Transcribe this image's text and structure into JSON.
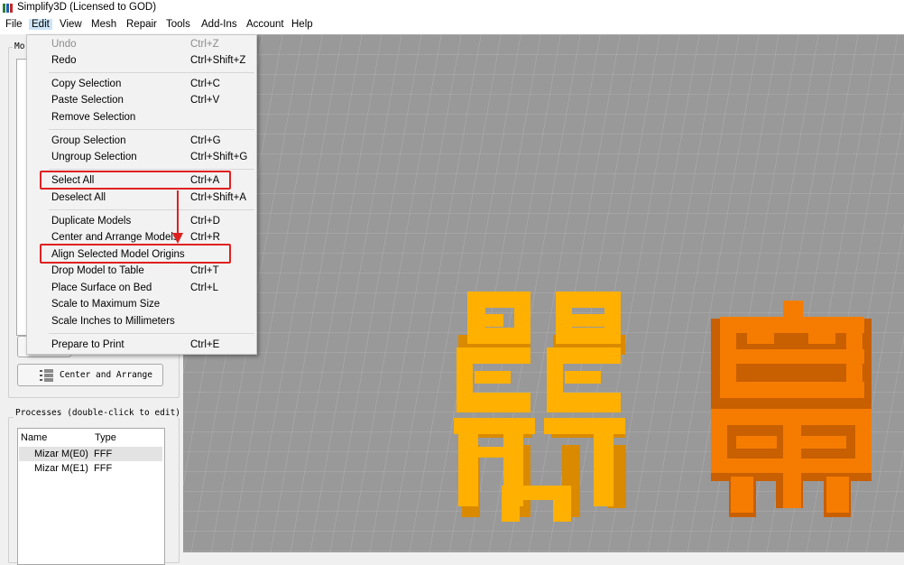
{
  "window": {
    "title": "Simplify3D (Licensed to GOD)"
  },
  "menubar": {
    "items": [
      "File",
      "Edit",
      "View",
      "Mesh",
      "Repair",
      "Tools",
      "Add-Ins",
      "Account",
      "Help"
    ]
  },
  "left_panel": {
    "models_group_label": "Mo",
    "center_arrange_label": "Center and Arrange",
    "processes_label": "Processes (double-click to edit)",
    "process_columns": [
      "Name",
      "Type"
    ],
    "processes": [
      {
        "name": "Mizar M(E0)",
        "type": "FFF"
      },
      {
        "name": "Mizar M(E1)",
        "type": "FFF"
      }
    ]
  },
  "edit_menu": {
    "items": [
      {
        "label": "Undo",
        "shortcut": "Ctrl+Z",
        "disabled": true
      },
      {
        "label": "Redo",
        "shortcut": "Ctrl+Shift+Z"
      },
      {
        "label": "Copy Selection",
        "shortcut": "Ctrl+C"
      },
      {
        "label": "Paste Selection",
        "shortcut": "Ctrl+V"
      },
      {
        "label": "Remove Selection",
        "shortcut": ""
      },
      {
        "label": "Group Selection",
        "shortcut": "Ctrl+G"
      },
      {
        "label": "Ungroup Selection",
        "shortcut": "Ctrl+Shift+G"
      },
      {
        "label": "Select All",
        "shortcut": "Ctrl+A"
      },
      {
        "label": "Deselect All",
        "shortcut": "Ctrl+Shift+A"
      },
      {
        "label": "Duplicate Models",
        "shortcut": "Ctrl+D"
      },
      {
        "label": "Center and Arrange Models",
        "shortcut": "Ctrl+R"
      },
      {
        "label": "Align Selected Model Origins",
        "shortcut": ""
      },
      {
        "label": "Drop Model to Table",
        "shortcut": "Ctrl+T"
      },
      {
        "label": "Place Surface on Bed",
        "shortcut": "Ctrl+L"
      },
      {
        "label": "Scale to Maximum Size",
        "shortcut": ""
      },
      {
        "label": "Scale Inches to Millimeters",
        "shortcut": ""
      },
      {
        "label": "Prepare to Print",
        "shortcut": "Ctrl+E"
      }
    ]
  },
  "colors": {
    "annotation": "#e02020",
    "model_yellow": "#ffb000",
    "model_orange": "#f57c00",
    "bed_grid": "#9a9a9a"
  }
}
